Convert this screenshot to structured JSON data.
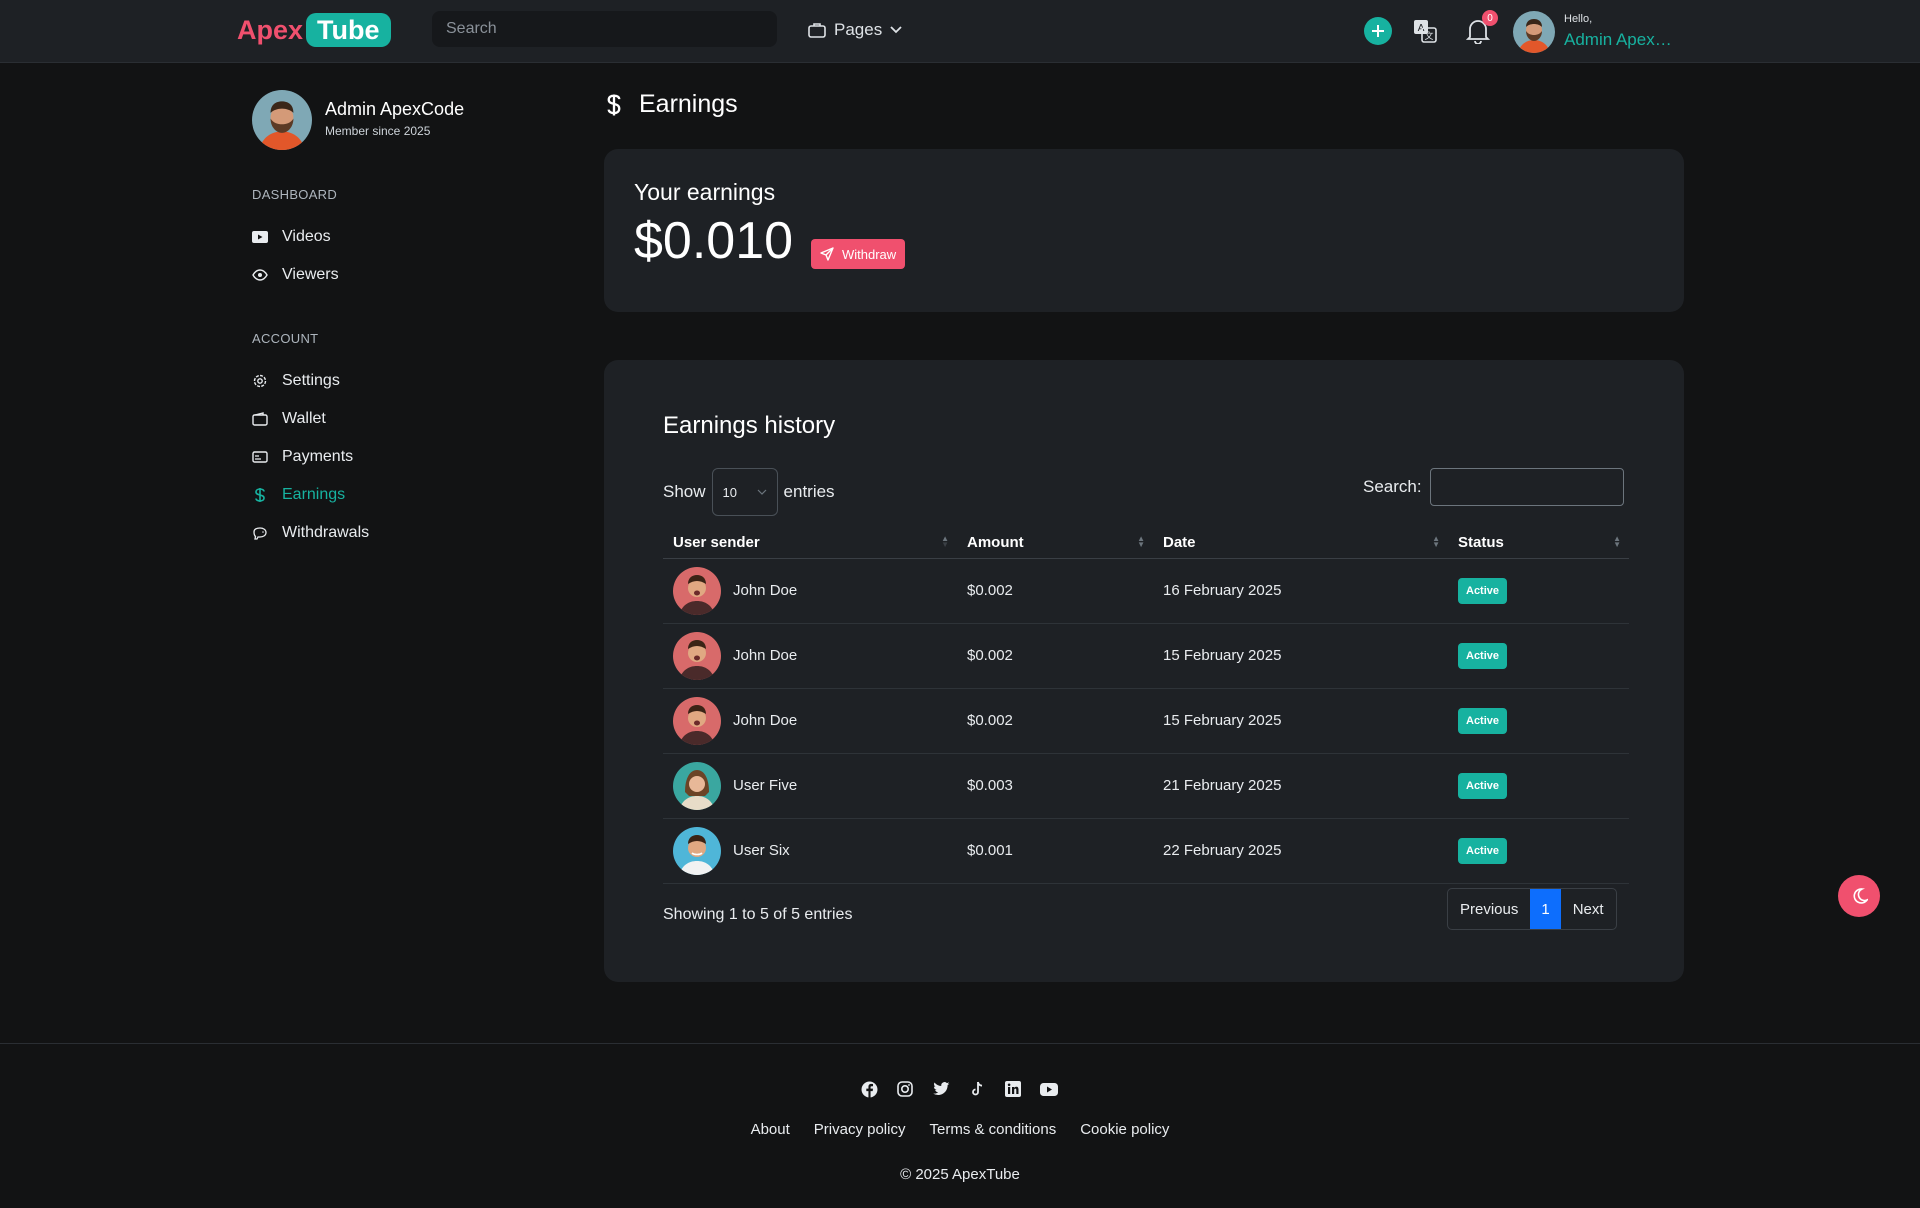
{
  "header": {
    "logo_apex": "Apex",
    "logo_tube": "Tube",
    "search_placeholder": "Search",
    "pages_label": "Pages",
    "notification_count": "0",
    "hello": "Hello,",
    "user_name": "Admin ApexCode"
  },
  "sidebar": {
    "name": "Admin ApexCode",
    "since": "Member since 2025",
    "section_dashboard": "DASHBOARD",
    "section_account": "ACCOUNT",
    "items": [
      {
        "label": "Videos",
        "icon": "video-icon"
      },
      {
        "label": "Viewers",
        "icon": "eye-icon"
      },
      {
        "label": "Settings",
        "icon": "gear-icon"
      },
      {
        "label": "Wallet",
        "icon": "wallet-icon"
      },
      {
        "label": "Payments",
        "icon": "card-icon"
      },
      {
        "label": "Earnings",
        "icon": "dollar-icon",
        "active": true
      },
      {
        "label": "Withdrawals",
        "icon": "piggy-bank-icon"
      }
    ]
  },
  "main": {
    "page_title": "Earnings",
    "your_earnings": "Your earnings",
    "amount": "$0.010",
    "withdraw_label": "Withdraw",
    "history_title": "Earnings history",
    "show_label": "Show",
    "entries_label": "entries",
    "page_length": "10",
    "search_label": "Search:",
    "columns": [
      "User sender",
      "Amount",
      "Date",
      "Status"
    ],
    "rows": [
      {
        "user": "John Doe",
        "amount": "$0.002",
        "date": "16 February 2025",
        "status": "Active"
      },
      {
        "user": "John Doe",
        "amount": "$0.002",
        "date": "15 February 2025",
        "status": "Active"
      },
      {
        "user": "John Doe",
        "amount": "$0.002",
        "date": "15 February 2025",
        "status": "Active"
      },
      {
        "user": "User Five",
        "amount": "$0.003",
        "date": "21 February 2025",
        "status": "Active"
      },
      {
        "user": "User Six",
        "amount": "$0.001",
        "date": "22 February 2025",
        "status": "Active"
      }
    ],
    "info": "Showing 1 to 5 of 5 entries",
    "pager": {
      "prev": "Previous",
      "current": "1",
      "next": "Next"
    }
  },
  "footer": {
    "links": [
      "About",
      "Privacy policy",
      "Terms & conditions",
      "Cookie policy"
    ],
    "copyright": "© 2025 ApexTube"
  },
  "colors": {
    "accent": "#17b2a0",
    "brand_red": "#f0506e",
    "pager_active": "#0d6efd"
  }
}
